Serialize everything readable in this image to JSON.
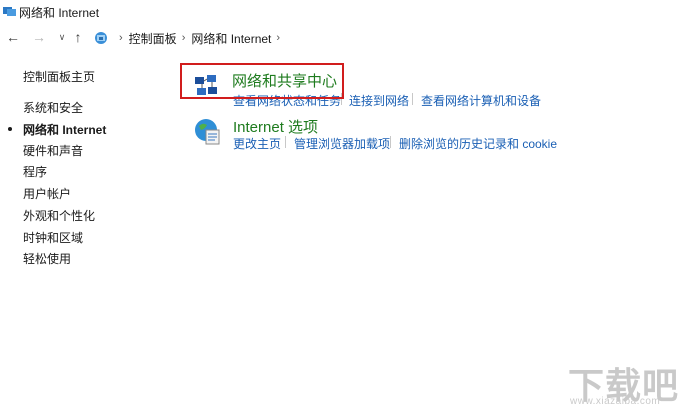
{
  "window": {
    "title": "网络和 Internet"
  },
  "address_bar": {
    "back_glyph": "←",
    "forward_glyph": "→",
    "dropdown_glyph": "∨",
    "up_glyph": "↑",
    "crumbs": [
      "控制面板",
      "网络和 Internet"
    ],
    "separator": "›"
  },
  "sidebar": {
    "home": "控制面板主页",
    "items": [
      {
        "label": "系统和安全",
        "active": false
      },
      {
        "label": "网络和 Internet",
        "active": true
      },
      {
        "label": "硬件和声音",
        "active": false
      },
      {
        "label": "程序",
        "active": false
      },
      {
        "label": "用户帐户",
        "active": false
      },
      {
        "label": "外观和个性化",
        "active": false
      },
      {
        "label": "时钟和区域",
        "active": false
      },
      {
        "label": "轻松使用",
        "active": false
      }
    ]
  },
  "main": {
    "categories": [
      {
        "title": "网络和共享中心",
        "icon": "network-sharing-center-icon",
        "links": [
          "查看网络状态和任务",
          "连接到网络",
          "查看网络计算机和设备"
        ]
      },
      {
        "title": "Internet 选项",
        "icon": "internet-options-icon",
        "links": [
          "更改主页",
          "管理浏览器加载项",
          "删除浏览的历史记录和 cookie"
        ]
      }
    ]
  },
  "watermark": {
    "text": "下载吧",
    "url": "www.xiazaiba.com"
  },
  "colors": {
    "link": "#1a5fb4",
    "category_title": "#1e7b1e",
    "highlight_border": "#d11d1d"
  }
}
